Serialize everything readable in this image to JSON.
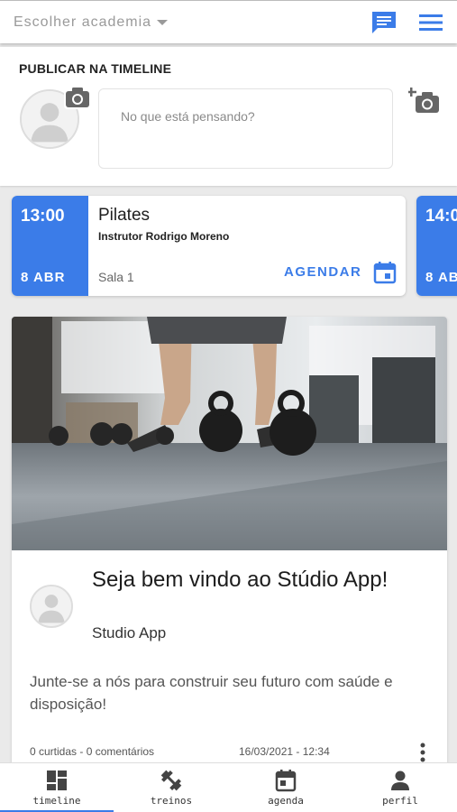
{
  "header": {
    "gym_select_label": "Escolher academia",
    "chat_icon": "chat-icon",
    "menu_icon": "hamburger-menu-icon"
  },
  "publish": {
    "title": "PUBLICAR NA TIMELINE",
    "placeholder": "No que está pensando?",
    "avatar_icon": "user-avatar-icon",
    "camera_icon": "camera-icon",
    "add_photo_icon": "add-photo-icon"
  },
  "classes": [
    {
      "time": "13:00",
      "date": "8 ABR",
      "name": "Pilates",
      "instructor": "Instrutor Rodrigo Moreno",
      "room": "Sala 1",
      "book_label": "AGENDAR"
    },
    {
      "time": "14:0",
      "date": "8 AB"
    }
  ],
  "post": {
    "title": "Seja bem vindo ao Stúdio App!",
    "author": "Studio App",
    "body": "Junte-se a nós para construir seu futuro com saúde e disposição!",
    "stats": "0 curtidas  - 0 comentários",
    "datetime": "16/03/2021 - 12:34"
  },
  "nav": {
    "items": [
      {
        "label": "timeline",
        "icon": "dashboard-icon",
        "active": true
      },
      {
        "label": "treinos",
        "icon": "dumbbell-icon",
        "active": false
      },
      {
        "label": "agenda",
        "icon": "calendar-icon",
        "active": false
      },
      {
        "label": "perfil",
        "icon": "person-icon",
        "active": false
      }
    ]
  },
  "colors": {
    "accent": "#3b7ce8"
  }
}
